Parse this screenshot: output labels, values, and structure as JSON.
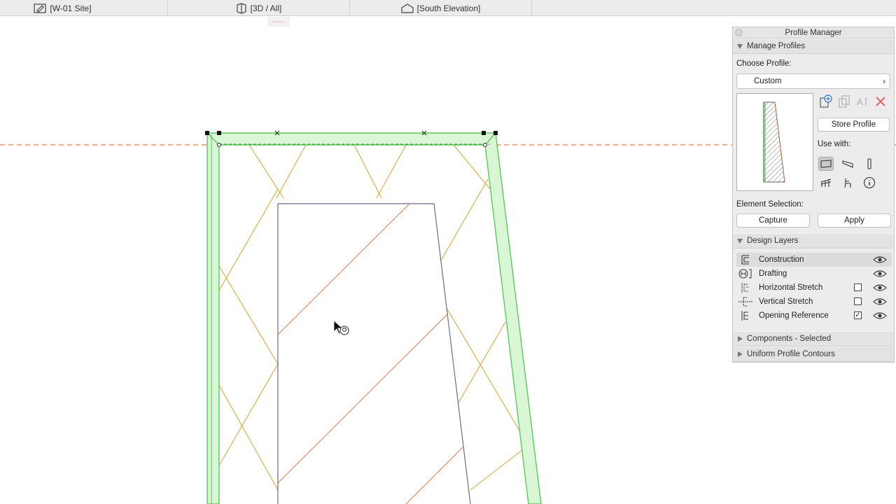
{
  "tabs": [
    {
      "label": "[W-01 Site]",
      "icon": "pencil-icon"
    },
    {
      "label": "[3D / All]",
      "icon": "cube-icon"
    },
    {
      "label": "[South Elevation]",
      "icon": "house-icon"
    }
  ],
  "tab_marker": "----",
  "colors": {
    "profile_green": "#5cc95c",
    "profile_fill": "#d9f7d5",
    "hatch_yellow": "#d9a93a",
    "orange_line": "#e8784a",
    "opening_stroke": "#6a6a8a"
  },
  "panel": {
    "title": "Profile Manager",
    "manage_section": "Manage Profiles",
    "choose_profile_label": "Choose Profile:",
    "profile_value": "Custom",
    "store_profile_label": "Store Profile",
    "use_with_label": "Use with:",
    "use_with_icons": [
      "wall-icon",
      "beam-icon",
      "column-icon",
      "railing-icon",
      "chair-icon",
      "info-icon"
    ],
    "element_selection_label": "Element Selection:",
    "capture_label": "Capture",
    "apply_label": "Apply",
    "design_layers_section": "Design Layers",
    "layers": [
      {
        "name": "Construction",
        "checkbox": "none",
        "selected": true
      },
      {
        "name": "Drafting",
        "checkbox": "none",
        "selected": false
      },
      {
        "name": "Horizontal Stretch",
        "checkbox": "unchecked",
        "selected": false
      },
      {
        "name": "Vertical Stretch",
        "checkbox": "unchecked",
        "selected": false
      },
      {
        "name": "Opening Reference",
        "checkbox": "checked",
        "selected": false
      }
    ],
    "checkbox_mark": "✓",
    "components_section": "Components - Selected",
    "uniform_section": "Uniform Profile Contours"
  }
}
